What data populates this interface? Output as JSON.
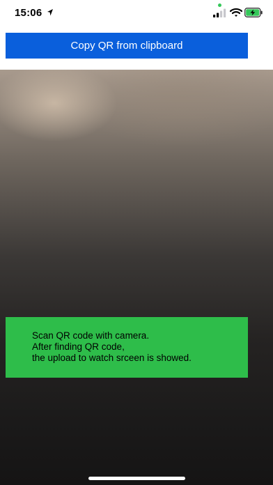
{
  "status_bar": {
    "time": "15:06",
    "location_icon": "location-arrow-icon",
    "signal_icon": "cellular-signal-icon",
    "wifi_icon": "wifi-icon",
    "battery_icon": "battery-charging-icon",
    "privacy_indicator_color": "#34c759",
    "battery_color": "#34c759"
  },
  "toolbar": {
    "copy_qr_label": "Copy QR from clipboard",
    "button_color": "#0a5fdc"
  },
  "camera": {
    "info_lines": [
      "Scan QR code with camera.",
      "After finding QR code,",
      "the upload to watch srceen is showed."
    ],
    "info_color": "#2ebd4a"
  }
}
